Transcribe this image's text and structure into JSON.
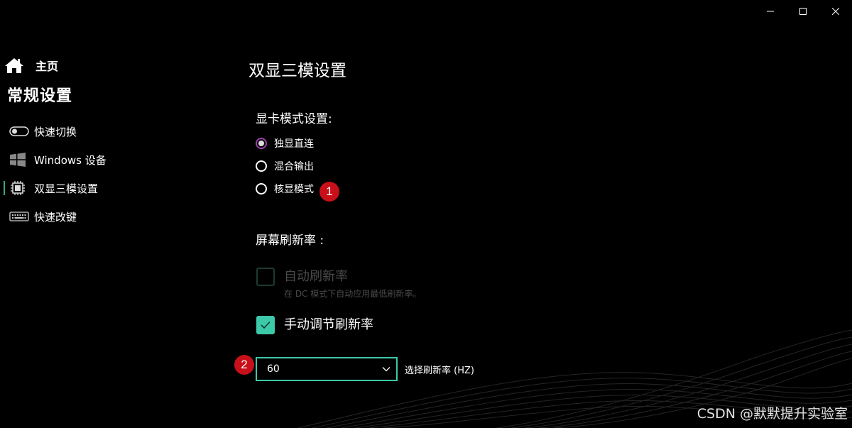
{
  "window": {
    "controls": {
      "minimize_icon": "minimize-icon",
      "maximize_icon": "maximize-icon",
      "close_icon": "close-icon"
    }
  },
  "sidebar": {
    "home_label": "主页",
    "section_title": "常规设置",
    "items": [
      {
        "label": "快速切换",
        "icon": "toggle-icon",
        "active": false
      },
      {
        "label": "Windows 设备",
        "icon": "windows-icon",
        "active": false
      },
      {
        "label": "双显三模设置",
        "icon": "chip-icon",
        "active": true
      },
      {
        "label": "快速改键",
        "icon": "keyboard-icon",
        "active": false
      }
    ]
  },
  "main": {
    "page_title": "双显三模设置",
    "gpu_mode": {
      "label": "显卡模式设置:",
      "options": [
        {
          "label": "独显直连",
          "checked": true
        },
        {
          "label": "混合输出",
          "checked": false
        },
        {
          "label": "核显模式",
          "checked": false
        }
      ],
      "badge": "1"
    },
    "refresh": {
      "label": "屏幕刷新率 :",
      "auto": {
        "label": "自动刷新率",
        "sub_label": "在 DC 模式下自动应用最低刷新率。",
        "checked": false,
        "disabled": true
      },
      "manual": {
        "label": "手动调节刷新率",
        "checked": true
      },
      "select": {
        "value": "60",
        "label": "选择刷新率 (HZ)"
      },
      "badge": "2"
    }
  },
  "watermark": "CSDN @默默提升实验室",
  "colors": {
    "accent": "#3cc9aa",
    "radio_checked": "#9b3fae",
    "badge": "#c8101a"
  }
}
